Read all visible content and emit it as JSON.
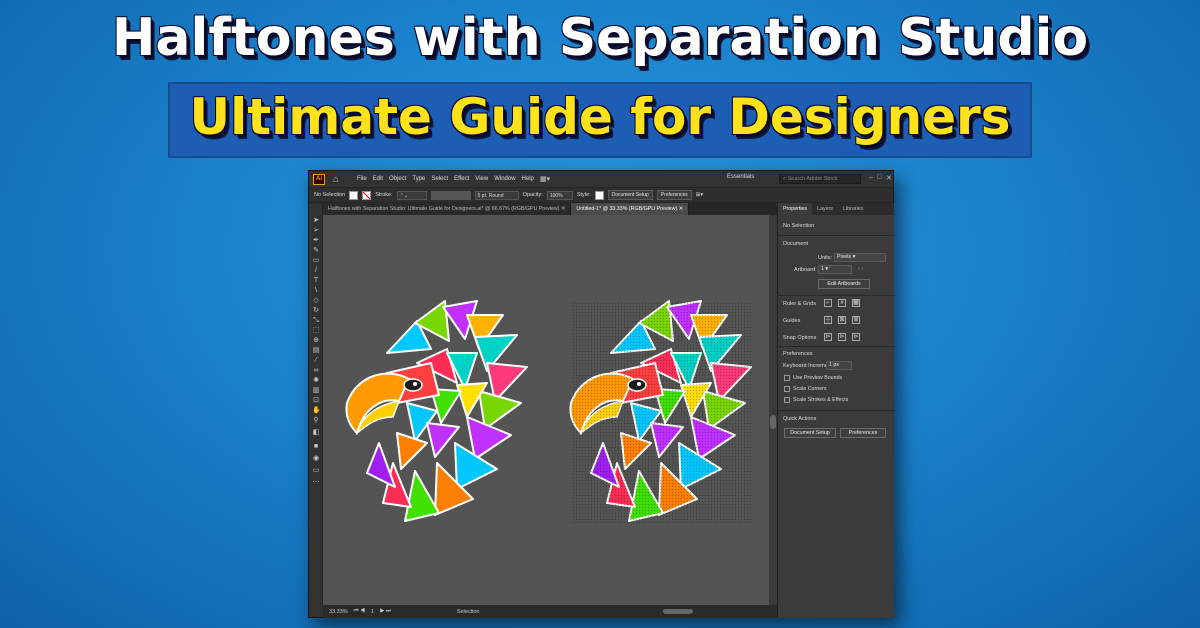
{
  "banner": {
    "line1": "Halftones with Separation Studio",
    "line2": "Ultimate Guide for Designers"
  },
  "app": {
    "logo": "Ai",
    "menu": [
      "File",
      "Edit",
      "Object",
      "Type",
      "Select",
      "Effect",
      "View",
      "Window",
      "Help"
    ],
    "workspace": "Essentials",
    "search_placeholder": "Search Adobe Stock"
  },
  "control_bar": {
    "selection": "No Selection",
    "stroke_label": "Stroke:",
    "brush": "5 pt. Round",
    "opacity_label": "Opacity:",
    "opacity": "100%",
    "style_label": "Style:",
    "doc_setup": "Document Setup",
    "preferences": "Preferences"
  },
  "tabs": [
    {
      "label": "Halftones with Separation Studio: Ultimate Guide for Designers.ai* @ 66.67% (RGB/GPU Preview)"
    },
    {
      "label": "Untitled-1* @ 33.33% (RGB/GPU Preview)"
    }
  ],
  "status_bar": {
    "zoom": "33.33%",
    "artboard": "1",
    "tool": "Selection"
  },
  "properties_panel": {
    "tabs": [
      "Properties",
      "Layers",
      "Libraries"
    ],
    "no_selection": "No Selection",
    "document": "Document",
    "units_label": "Units:",
    "units": "Pixels",
    "artboard_label": "Artboard:",
    "artboard": "1",
    "edit_artboards": "Edit Artboards",
    "rulers_grids": "Ruler & Grids",
    "guides": "Guides",
    "snap_options": "Snap Options",
    "preferences": "Preferences",
    "keyboard_increment_label": "Keyboard Increment:",
    "keyboard_increment": "1 px",
    "checkboxes": [
      "Use Preview Bounds",
      "Scale Corners",
      "Scale Strokes & Effects"
    ],
    "quick_actions": "Quick Actions",
    "doc_setup_btn": "Document Setup",
    "preferences_btn": "Preferences"
  },
  "colors": {
    "background": "#1a82cc",
    "title_white": "#ffffff",
    "title_yellow": "#ffe21a",
    "band": "#1d5db4",
    "canvas": "#545454"
  },
  "icons": [
    "home-icon",
    "ai-logo-icon",
    "search-icon",
    "selection-tool-icon",
    "direct-selection-tool-icon",
    "pen-tool-icon",
    "type-tool-icon",
    "zoom-tool-icon",
    "hand-tool-icon",
    "eagle-illustration-icon"
  ]
}
